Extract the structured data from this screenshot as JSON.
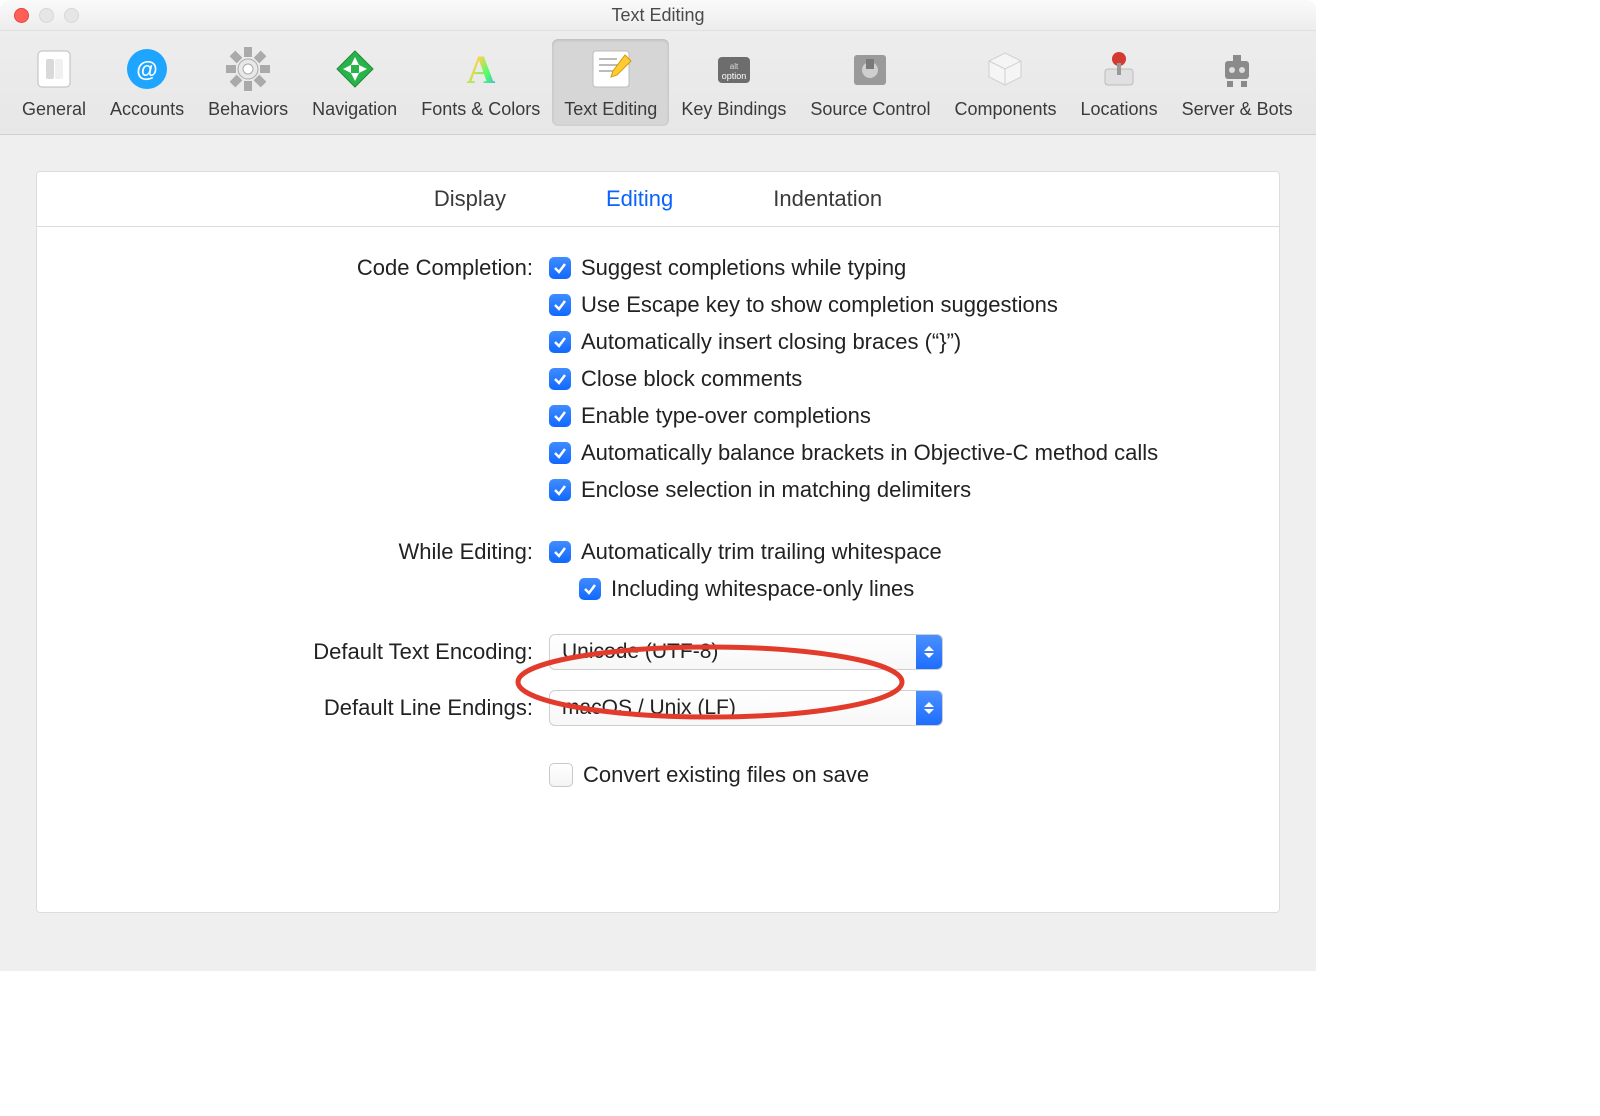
{
  "window": {
    "title": "Text Editing"
  },
  "toolbar": {
    "items": [
      {
        "key": "general",
        "label": "General"
      },
      {
        "key": "accounts",
        "label": "Accounts"
      },
      {
        "key": "behaviors",
        "label": "Behaviors"
      },
      {
        "key": "navigation",
        "label": "Navigation"
      },
      {
        "key": "fonts-colors",
        "label": "Fonts & Colors"
      },
      {
        "key": "text-editing",
        "label": "Text Editing",
        "selected": true
      },
      {
        "key": "key-bindings",
        "label": "Key Bindings"
      },
      {
        "key": "source-control",
        "label": "Source Control"
      },
      {
        "key": "components",
        "label": "Components"
      },
      {
        "key": "locations",
        "label": "Locations"
      },
      {
        "key": "server-bots",
        "label": "Server & Bots"
      }
    ]
  },
  "subtabs": {
    "items": [
      {
        "key": "display",
        "label": "Display"
      },
      {
        "key": "editing",
        "label": "Editing",
        "active": true
      },
      {
        "key": "indentation",
        "label": "Indentation"
      }
    ]
  },
  "sections": {
    "code_completion": {
      "label": "Code Completion:",
      "options": [
        {
          "label": "Suggest completions while typing",
          "checked": true
        },
        {
          "label": "Use Escape key to show completion suggestions",
          "checked": true
        },
        {
          "label": "Automatically insert closing braces (“}”)",
          "checked": true
        },
        {
          "label": "Close block comments",
          "checked": true
        },
        {
          "label": "Enable type-over completions",
          "checked": true
        },
        {
          "label": "Automatically balance brackets in Objective-C method calls",
          "checked": true
        },
        {
          "label": "Enclose selection in matching delimiters",
          "checked": true
        }
      ]
    },
    "while_editing": {
      "label": "While Editing:",
      "options": [
        {
          "label": "Automatically trim trailing whitespace",
          "checked": true
        },
        {
          "label": "Including whitespace-only lines",
          "checked": true,
          "indent": true,
          "highlighted": true
        }
      ]
    },
    "default_text_encoding": {
      "label": "Default Text Encoding:",
      "value": "Unicode (UTF-8)"
    },
    "default_line_endings": {
      "label": "Default Line Endings:",
      "value": "macOS / Unix (LF)"
    },
    "convert_existing": {
      "label": "Convert existing files on save",
      "checked": false
    }
  }
}
